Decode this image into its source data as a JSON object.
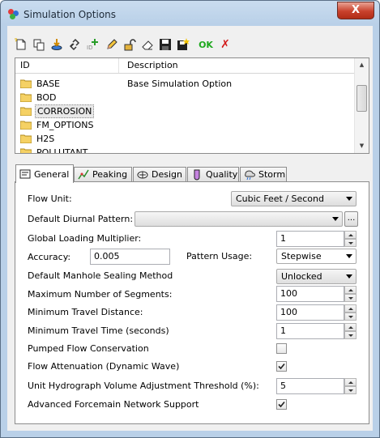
{
  "window": {
    "title": "Simulation Options",
    "close_label": "X"
  },
  "toolbar": {
    "ok_label": "OK",
    "cancel_label": "✗"
  },
  "list": {
    "headers": {
      "id": "ID",
      "description": "Description"
    },
    "rows": [
      {
        "id": "BASE",
        "description": "Base Simulation Option"
      },
      {
        "id": "BOD",
        "description": ""
      },
      {
        "id": "CORROSION",
        "description": ""
      },
      {
        "id": "FM_OPTIONS",
        "description": ""
      },
      {
        "id": "H2S",
        "description": ""
      },
      {
        "id": "POLLUTANT",
        "description": ""
      }
    ]
  },
  "tabs": [
    {
      "label": "General"
    },
    {
      "label": "Peaking"
    },
    {
      "label": "Design"
    },
    {
      "label": "Quality"
    },
    {
      "label": "Storm"
    }
  ],
  "general": {
    "flow_unit": {
      "label": "Flow Unit:",
      "value": "Cubic Feet / Second"
    },
    "diurnal": {
      "label": "Default Diurnal Pattern:",
      "value": "",
      "browse": "..."
    },
    "loading_multiplier": {
      "label": "Global Loading Multiplier:",
      "value": "1"
    },
    "accuracy": {
      "label": "Accuracy:",
      "value": "0.005"
    },
    "pattern_usage": {
      "label": "Pattern Usage:",
      "value": "Stepwise"
    },
    "manhole_sealing": {
      "label": "Default Manhole Sealing Method",
      "value": "Unlocked"
    },
    "max_segments": {
      "label": "Maximum Number of Segments:",
      "value": "100"
    },
    "min_travel_distance": {
      "label": "Minimum Travel Distance:",
      "value": "100"
    },
    "min_travel_time": {
      "label": "Minimum Travel Time (seconds)",
      "value": "1"
    },
    "pumped_flow": {
      "label": "Pumped Flow Conservation",
      "checked": false
    },
    "flow_attenuation": {
      "label": "Flow Attenuation (Dynamic Wave)",
      "checked": true
    },
    "hydrograph_threshold": {
      "label": "Unit Hydrograph Volume Adjustment Threshold (%):",
      "value": "5"
    },
    "forcemain_support": {
      "label": "Advanced Forcemain Network Support",
      "checked": true
    }
  }
}
